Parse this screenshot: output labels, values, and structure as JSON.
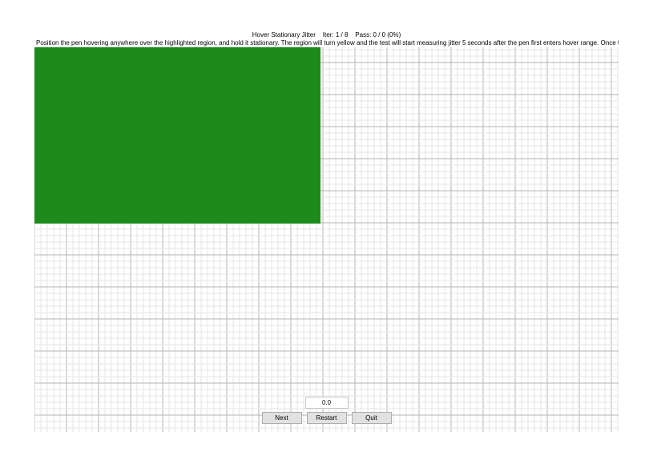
{
  "header": {
    "test_name": "Hover Stationary Jitter",
    "iter_label": "Iter:",
    "iter_current": 1,
    "iter_total": 8,
    "pass_label": "Pass:",
    "pass_count": 0,
    "pass_total": 0,
    "pass_percent": "0%",
    "instruction": "Position the pen hovering anywhere over the highlighted region, and hold it stationary. The region will turn yellow and the test will start measuring jitter 5 seconds after the pen first enters hover range. Once the region turns green again, lift the pen."
  },
  "highlight": {
    "color": "#1c8b1c"
  },
  "readout": {
    "value": "0.0"
  },
  "buttons": {
    "next": "Next",
    "restart": "Restart",
    "quit": "Quit"
  },
  "grid": {
    "minor_spacing": 8,
    "major_every": 5
  }
}
